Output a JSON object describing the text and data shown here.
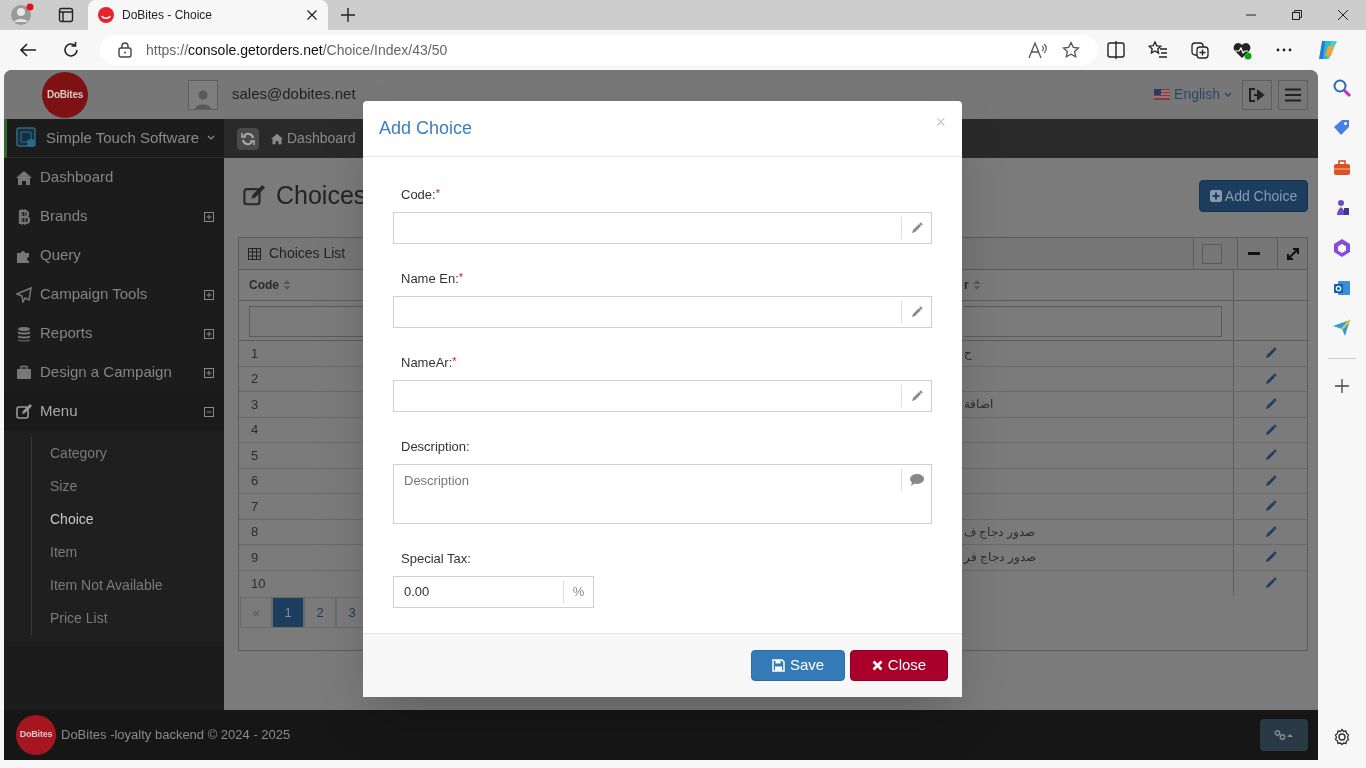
{
  "browser": {
    "tab": {
      "title": "DoBites - Choice",
      "selected": true
    },
    "url": {
      "scheme": "https://",
      "host": "console.getorders.net",
      "path": "/Choice/Index/43/50"
    }
  },
  "header": {
    "logo_text": "DoBites",
    "user_email": "sales@dobites.net",
    "language": "English"
  },
  "sidebar": {
    "org": "Simple Touch Software",
    "items": [
      {
        "label": "Dashboard",
        "kind": "link",
        "expanded": false
      },
      {
        "label": "Brands",
        "kind": "group",
        "expanded": false
      },
      {
        "label": "Query",
        "kind": "link",
        "expanded": false
      },
      {
        "label": "Campaign Tools",
        "kind": "group",
        "expanded": false
      },
      {
        "label": "Reports",
        "kind": "group",
        "expanded": false
      },
      {
        "label": "Design a Campaign",
        "kind": "group",
        "expanded": false
      },
      {
        "label": "Menu",
        "kind": "group",
        "expanded": true,
        "children": [
          {
            "label": "Category",
            "selected": false
          },
          {
            "label": "Size",
            "selected": false
          },
          {
            "label": "Choice",
            "selected": true
          },
          {
            "label": "Item",
            "selected": false
          },
          {
            "label": "Item Not Available",
            "selected": false
          },
          {
            "label": "Price List",
            "selected": false
          }
        ]
      }
    ]
  },
  "breadcrumb": [
    {
      "label": "Dashboard"
    }
  ],
  "page": {
    "title": "Choices",
    "add_button": "Add Choice"
  },
  "table": {
    "title": "Choices List",
    "columns": [
      {
        "label": "Code"
      },
      {
        "label": "r"
      }
    ],
    "rows": [
      {
        "code": "1",
        "name_ar": "ح"
      },
      {
        "code": "2"
      },
      {
        "code": "3",
        "name_ar": "اضافة"
      },
      {
        "code": "4"
      },
      {
        "code": "5"
      },
      {
        "code": "6"
      },
      {
        "code": "7"
      },
      {
        "code": "8",
        "name_ar": "صدور دجاج ف"
      },
      {
        "code": "9",
        "name_ar": "صدور دجاج فر"
      },
      {
        "code": "10"
      }
    ],
    "pagination": [
      {
        "label": "«",
        "selected": false
      },
      {
        "label": "1",
        "selected": true
      },
      {
        "label": "2",
        "selected": false
      },
      {
        "label": "3",
        "selected": false
      }
    ]
  },
  "modal": {
    "title": "Add Choice",
    "close": "×",
    "fields": [
      {
        "label": "Code:",
        "required_mark": "*",
        "kind": "text"
      },
      {
        "label": "Name En:",
        "required_mark": "*",
        "kind": "text"
      },
      {
        "label": "NameAr:",
        "required_mark": "*",
        "kind": "text"
      },
      {
        "label": "Description:",
        "kind": "textarea",
        "placeholder": "Description"
      },
      {
        "label": "Special Tax:",
        "kind": "number",
        "value": "0.00",
        "addon": "%"
      }
    ],
    "buttons": [
      {
        "label": "Save",
        "kind": "primary"
      },
      {
        "label": "Close",
        "kind": "danger"
      }
    ]
  },
  "footer": {
    "logo_text": "DoBites",
    "text": "DoBites -loyalty backend © 2024 - 2025"
  }
}
